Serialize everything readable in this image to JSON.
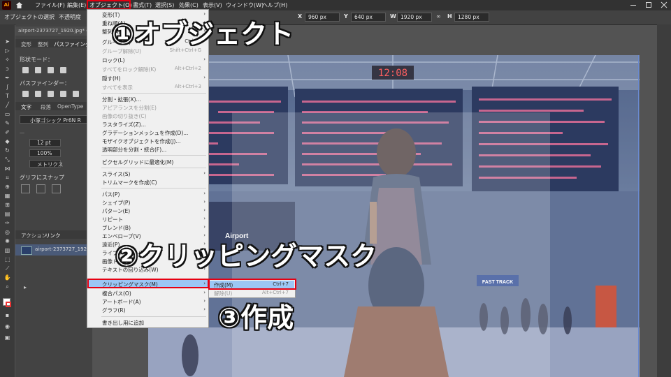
{
  "menubar": {
    "items": [
      "ファイル(F)",
      "編集(E)",
      "オブジェクト(O)",
      "書式(T)",
      "選択(S)",
      "効果(C)",
      "表示(V)",
      "ウィンドウ(W)",
      "ヘルプ(H)"
    ],
    "app_logo": "Ai"
  },
  "controlbar": {
    "left_label": "オブジェクトの選択",
    "opacity_label": "不透明度",
    "x_label": "X",
    "x_value": "960 px",
    "y_label": "Y",
    "y_value": "640 px",
    "w_label": "W",
    "w_value": "1920 px",
    "h_label": "H",
    "h_value": "1280 px"
  },
  "document": {
    "tab_title": "airport-2373727_1920.jpg* @ 16.6"
  },
  "panels": {
    "tabs_top": [
      "変形",
      "整列",
      "パスファインダー"
    ],
    "shape_mode_label": "形状モード：",
    "pathfinder_label": "パスファインダー：",
    "text_tabs": [
      "文字",
      "段落",
      "OpenType"
    ],
    "font_name": "小塚ゴシック Pr6N R",
    "font_size": "12 pt",
    "scale": "100%",
    "tracking": "メトリクス",
    "snap_label": "グリフにスナップ",
    "lower_tabs": [
      "アクション",
      "リンク"
    ],
    "link_item": "airport-2373727_1920..."
  },
  "menu": {
    "items": [
      {
        "label": "変形(T)",
        "shortcut": "",
        "arrow": true,
        "disabled": false
      },
      {
        "label": "重ね順(A)",
        "shortcut": "",
        "arrow": true,
        "disabled": false
      },
      {
        "label": "整列(A)",
        "shortcut": "",
        "arrow": true,
        "disabled": false
      },
      {
        "label": "グループ(G)",
        "shortcut": "Ctrl+G",
        "arrow": false,
        "disabled": false
      },
      {
        "label": "グループ解除(U)",
        "shortcut": "Shift+Ctrl+G",
        "arrow": false,
        "disabled": false
      },
      {
        "label": "ロック(L)",
        "shortcut": "",
        "arrow": true,
        "disabled": false
      },
      {
        "label": "すべてをロック解除(K)",
        "shortcut": "Alt+Ctrl+2",
        "arrow": false,
        "disabled": true
      },
      {
        "label": "隠す(H)",
        "shortcut": "",
        "arrow": true,
        "disabled": false
      },
      {
        "label": "すべてを表示",
        "shortcut": "Alt+Ctrl+3",
        "arrow": false,
        "disabled": true
      },
      {
        "label": "分割・拡張(X)...",
        "shortcut": "",
        "arrow": false,
        "disabled": false
      },
      {
        "label": "アピアランスを分割(E)",
        "shortcut": "",
        "arrow": false,
        "disabled": true
      },
      {
        "label": "画像の切り抜き(C)",
        "shortcut": "",
        "arrow": false,
        "disabled": true
      },
      {
        "label": "ラスタライズ(Z)...",
        "shortcut": "",
        "arrow": false,
        "disabled": false
      },
      {
        "label": "グラデーションメッシュを作成(D)...",
        "shortcut": "",
        "arrow": false,
        "disabled": false
      },
      {
        "label": "モザイクオブジェクトを作成(J)...",
        "shortcut": "",
        "arrow": false,
        "disabled": false
      },
      {
        "label": "透明部分を分割・統合(F)...",
        "shortcut": "",
        "arrow": false,
        "disabled": false
      },
      {
        "label": "ピクセルグリッドに最適化(M)",
        "shortcut": "",
        "arrow": false,
        "disabled": false
      },
      {
        "label": "スライス(S)",
        "shortcut": "",
        "arrow": true,
        "disabled": false
      },
      {
        "label": "トリムマークを作成(C)",
        "shortcut": "",
        "arrow": false,
        "disabled": false
      },
      {
        "label": "パス(P)",
        "shortcut": "",
        "arrow": true,
        "disabled": false
      },
      {
        "label": "シェイプ(P)",
        "shortcut": "",
        "arrow": true,
        "disabled": false
      },
      {
        "label": "パターン(E)",
        "shortcut": "",
        "arrow": true,
        "disabled": false
      },
      {
        "label": "リピート",
        "shortcut": "",
        "arrow": true,
        "disabled": false
      },
      {
        "label": "ブレンド(B)",
        "shortcut": "",
        "arrow": true,
        "disabled": false
      },
      {
        "label": "エンベロープ(V)",
        "shortcut": "",
        "arrow": true,
        "disabled": false
      },
      {
        "label": "遠近(P)",
        "shortcut": "",
        "arrow": true,
        "disabled": false
      },
      {
        "label": "ライブペイント(N)",
        "shortcut": "",
        "arrow": true,
        "disabled": false
      },
      {
        "label": "画像トレース",
        "shortcut": "",
        "arrow": true,
        "disabled": false
      },
      {
        "label": "テキストの回り込み(W)",
        "shortcut": "",
        "arrow": true,
        "disabled": false
      },
      {
        "label": "クリッピングマスク(M)",
        "shortcut": "",
        "arrow": true,
        "disabled": false
      },
      {
        "label": "複合パス(O)",
        "shortcut": "",
        "arrow": true,
        "disabled": false
      },
      {
        "label": "アートボード(A)",
        "shortcut": "",
        "arrow": true,
        "disabled": false
      },
      {
        "label": "グラフ(R)",
        "shortcut": "",
        "arrow": true,
        "disabled": false
      },
      {
        "label": "書き出し用に追加",
        "shortcut": "",
        "arrow": true,
        "disabled": false
      }
    ]
  },
  "submenu": {
    "create_label": "作成(M)",
    "create_shortcut": "Ctrl+7",
    "release_label": "解除(U)",
    "release_shortcut": "Alt+Ctrl+7"
  },
  "photo": {
    "clock_text": "12:08",
    "sign_airport": "Airport",
    "fast_track": "FAST TRACK"
  },
  "annotations": {
    "step1": "①オブジェクト",
    "step2": "②クリッピングマスク",
    "step3": "③作成"
  },
  "colors": {
    "highlight": "#e60012",
    "menu_selected": "#9cc7f5",
    "board_led": "#e05a8a"
  }
}
